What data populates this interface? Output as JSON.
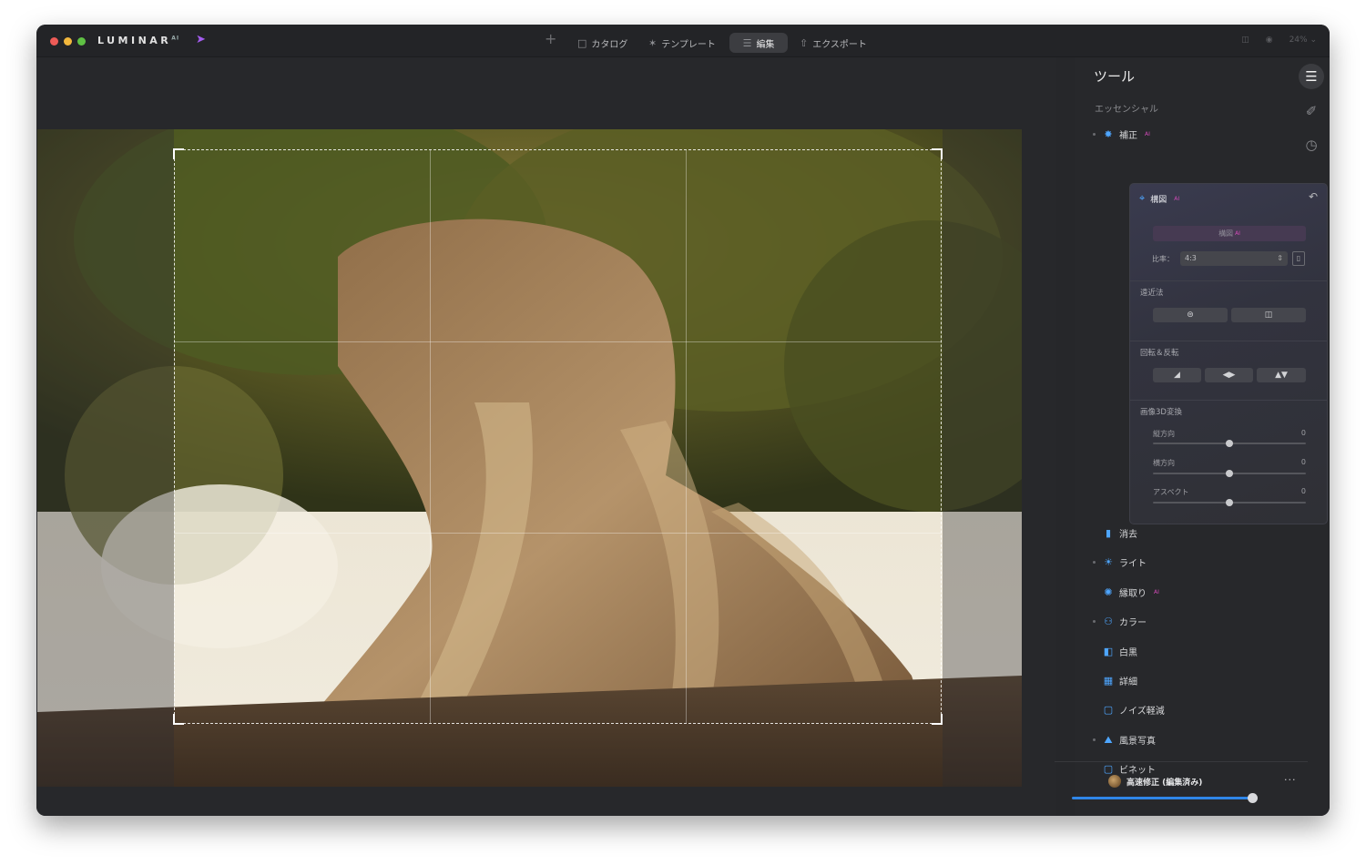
{
  "app": {
    "name": "LUMINAR",
    "badge": "AI"
  },
  "topnav": {
    "add": "+",
    "catalog": "カタログ",
    "templates": "テンプレート",
    "edit": "編集",
    "export": "エクスポート",
    "zoom": "24%"
  },
  "panel": {
    "title": "ツール",
    "section": "エッセンシャル",
    "enhance": "補正",
    "compose": {
      "title": "構図",
      "ai_button": "構図",
      "ratio_label": "比率：",
      "ratio_value": "4:3",
      "perspective_label": "遠近法",
      "rotate_label": "回転＆反転",
      "transform_label": "画像3D変換",
      "sliders": [
        {
          "label": "縦方向",
          "value": "0"
        },
        {
          "label": "横方向",
          "value": "0"
        },
        {
          "label": "アスペクト",
          "value": "0"
        }
      ]
    },
    "tools": [
      {
        "label": "消去"
      },
      {
        "label": "ライト"
      },
      {
        "label": "縁取り"
      },
      {
        "label": "カラー"
      },
      {
        "label": "白黒"
      },
      {
        "label": "詳細"
      },
      {
        "label": "ノイズ軽減"
      },
      {
        "label": "風景写真"
      },
      {
        "label": "ビネット"
      }
    ],
    "preset": {
      "label": "高速修正 (編集済み)",
      "more": "···",
      "amount": 1.0
    }
  },
  "colors": {
    "accent": "#4ea6ff",
    "ai": "#d24ab8",
    "close": "#ee5b57",
    "minimize": "#f2b73c",
    "zoom": "#5fc144"
  }
}
